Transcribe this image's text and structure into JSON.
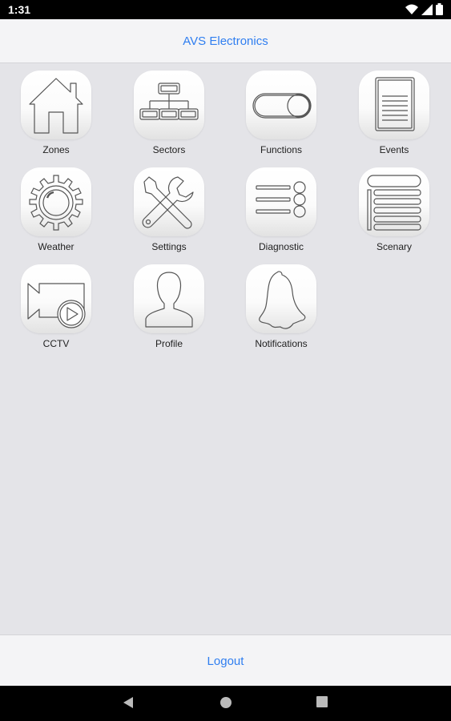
{
  "status_bar": {
    "time": "1:31",
    "icons": [
      "wifi-icon",
      "signal-icon",
      "battery-icon"
    ]
  },
  "header": {
    "title": "AVS Electronics"
  },
  "tiles": [
    {
      "label": "Zones",
      "icon": "house-icon"
    },
    {
      "label": "Sectors",
      "icon": "hierarchy-icon"
    },
    {
      "label": "Functions",
      "icon": "toggle-icon"
    },
    {
      "label": "Events",
      "icon": "document-icon"
    },
    {
      "label": "Weather",
      "icon": "sun-icon"
    },
    {
      "label": "Settings",
      "icon": "tools-icon"
    },
    {
      "label": "Diagnostic",
      "icon": "checklist-icon"
    },
    {
      "label": "Scenary",
      "icon": "list-layers-icon"
    },
    {
      "label": "CCTV",
      "icon": "camera-icon"
    },
    {
      "label": "Profile",
      "icon": "person-icon"
    },
    {
      "label": "Notifications",
      "icon": "bell-icon"
    }
  ],
  "footer": {
    "logout_label": "Logout"
  },
  "nav_bar": {
    "buttons": [
      "back-icon",
      "home-icon",
      "recents-icon"
    ]
  },
  "colors": {
    "accent": "#2f7ef0",
    "background": "#e4e4e8",
    "bar": "#f4f4f6"
  }
}
